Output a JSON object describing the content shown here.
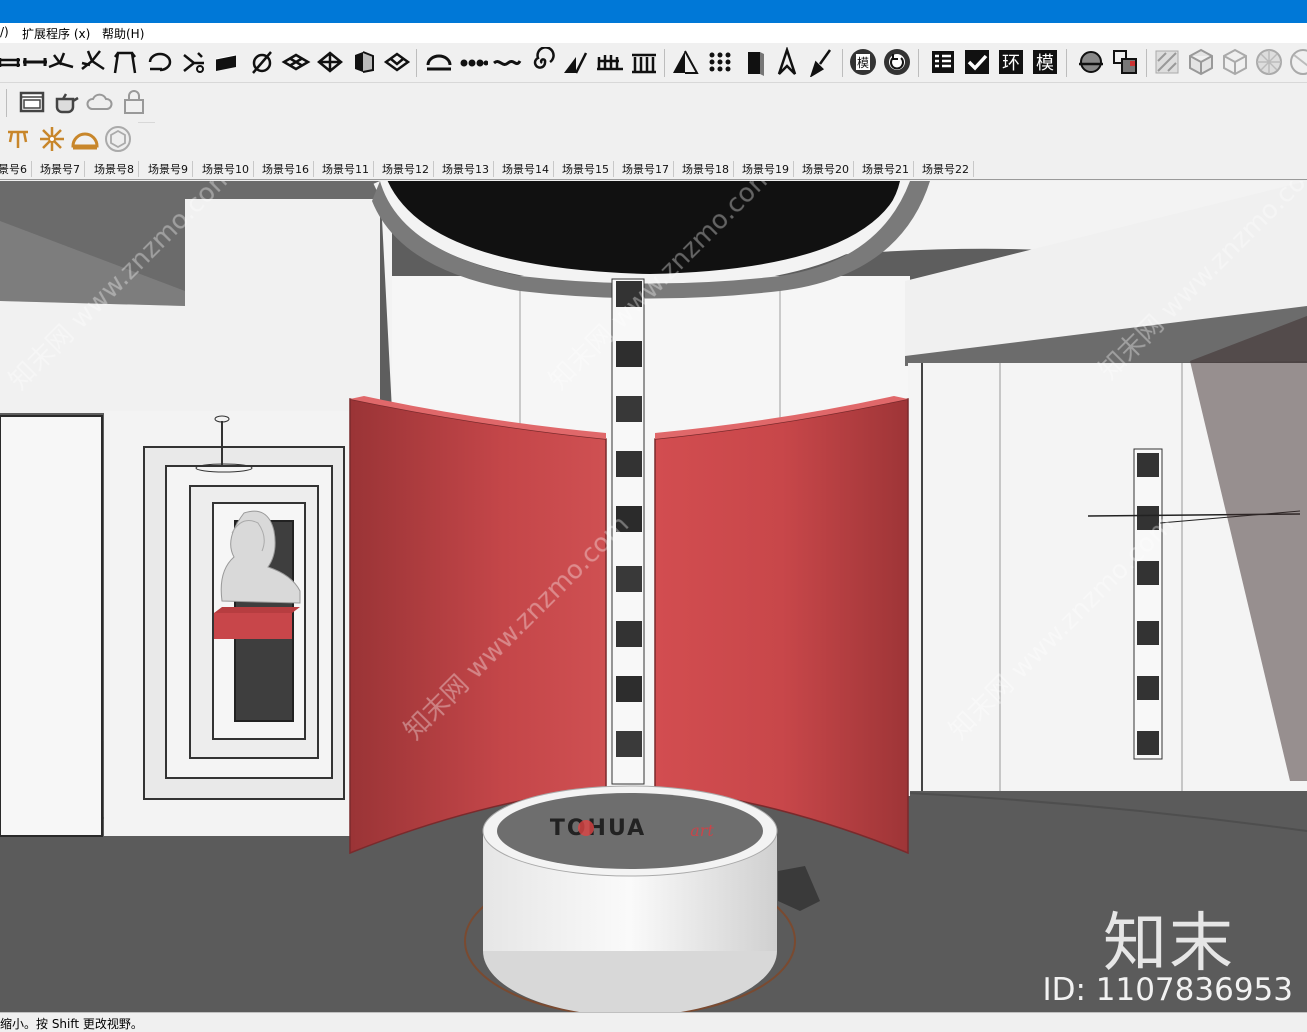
{
  "menu": {
    "partial_left": "/)",
    "extensions": "扩展程序 (x)",
    "help": "帮助(H)"
  },
  "toolbar_main": {
    "icons": [
      "dim-line-icon",
      "measure-icon",
      "fold-icon",
      "branch-icon",
      "frame-icon",
      "rotate-icon",
      "split-icon",
      "slab-icon",
      "node-icon",
      "grid-icon",
      "dice-icon",
      "box-icon",
      "shovel-icon",
      "arc-icon",
      "chain-icon",
      "wave-icon",
      "spiral-icon",
      "ramp-icon",
      "fence-icon",
      "column-icon",
      "triangle-icon",
      "dots-icon",
      "door-icon",
      "pen-icon",
      "brush-icon",
      "label-icon",
      "refresh-icon",
      "table-icon",
      "check-icon",
      "environment-icon",
      "model-icon",
      "sphere-icon",
      "group-icon",
      "hatch-icon",
      "cube-icon",
      "cube-outline-icon",
      "globe-icon",
      "globe-outline-icon"
    ],
    "text_glyphs": {
      "environment": "环",
      "model": "模",
      "label": "模"
    }
  },
  "toolbar_second": {
    "icons": [
      "window-frame-icon",
      "teapot-icon",
      "cloud-icon",
      "lock-icon"
    ]
  },
  "toolbar_third": {
    "icons": [
      "lamp-icon",
      "sun-icon",
      "dome-icon",
      "cube-light-icon"
    ]
  },
  "scenes": [
    "景号6",
    "场景号7",
    "场景号8",
    "场景号9",
    "场景号10",
    "场景号16",
    "场景号11",
    "场景号12",
    "场景号13",
    "场景号14",
    "场景号15",
    "场景号17",
    "场景号18",
    "场景号19",
    "场景号20",
    "场景号21",
    "场景号22"
  ],
  "viewport": {
    "logo_text": "TOHUA",
    "logo_script": "art",
    "colors": {
      "red": "#c8464a",
      "floor": "#5b5b5b",
      "wall": "#f2f2f2",
      "ceiling": "#6a6a6a"
    }
  },
  "watermark": {
    "brand": "知末",
    "id_text": "ID: 1107836953",
    "diagonal": "知末网 www.znzmo.com"
  },
  "status": {
    "text": "缩小。按 Shift 更改视野。"
  }
}
